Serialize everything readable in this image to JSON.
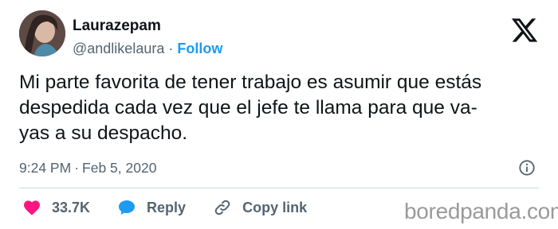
{
  "author": {
    "display_name": "Laurazepam",
    "handle": "@andlikelaura",
    "separator": "·",
    "follow_label": "Follow"
  },
  "tweet": {
    "text": "Mi parte favorita de tener trabajo es asumir que estás\ndespedida cada vez que el jefe te llama para que va-\nyas a su despacho."
  },
  "meta": {
    "time": "9:24 PM",
    "separator": "·",
    "date": "Feb 5, 2020"
  },
  "actions": {
    "like_count": "33.7K",
    "reply_label": "Reply",
    "copy_link_label": "Copy link"
  },
  "watermark": "boredpanda.com",
  "icons": {
    "platform": "x-logo-icon",
    "info": "info-icon",
    "like": "heart-icon",
    "reply": "speech-bubble-icon",
    "copy_link": "link-icon"
  },
  "colors": {
    "accent": "#1d9bf0",
    "like": "#f91880",
    "text": "#0f1419",
    "secondary_text": "#536471",
    "divider": "#cfd9de"
  }
}
